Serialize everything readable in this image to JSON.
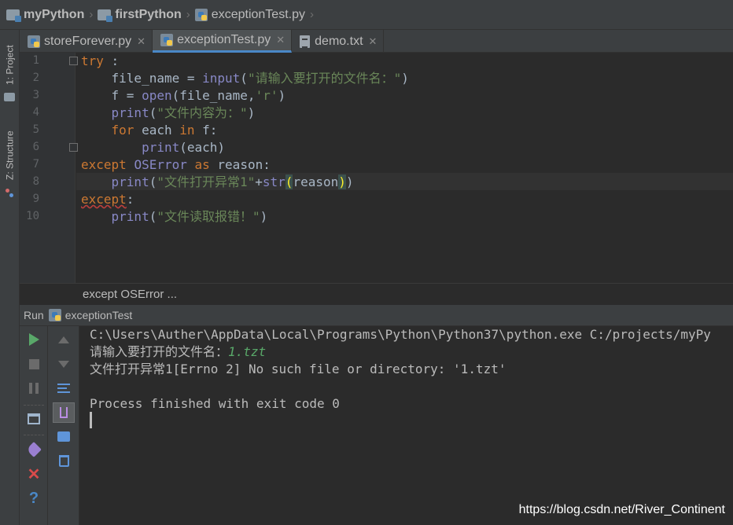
{
  "breadcrumb": [
    {
      "label": "myPython",
      "icon": "folder-icon"
    },
    {
      "label": "firstPython",
      "icon": "folder-icon"
    },
    {
      "label": "exceptionTest.py",
      "icon": "python-file-icon"
    }
  ],
  "sidebar": {
    "project_tab": "1: Project",
    "structure_tab": "Z: Structure"
  },
  "tabs": [
    {
      "label": "storeForever.py",
      "icon": "python-file-icon",
      "active": false
    },
    {
      "label": "exceptionTest.py",
      "icon": "python-file-icon",
      "active": true
    },
    {
      "label": "demo.txt",
      "icon": "text-file-icon",
      "active": false
    }
  ],
  "editor": {
    "line_numbers": [
      "1",
      "2",
      "3",
      "4",
      "5",
      "6",
      "7",
      "8",
      "9",
      "10"
    ],
    "lines": {
      "l1_kw": "try",
      "l1_rest": " :",
      "l2_a": "    file_name = ",
      "l2_fn": "input",
      "l2_b": "(",
      "l2_str": "\"请输入要打开的文件名：\"",
      "l2_c": ")",
      "l3_a": "    f = ",
      "l3_fn": "open",
      "l3_b": "(file_name,",
      "l3_str": "'r'",
      "l3_c": ")",
      "l4_fn": "    print",
      "l4_b": "(",
      "l4_str": "\"文件内容为：\"",
      "l4_c": ")",
      "l5_kw1": "    for",
      "l5_a": " each ",
      "l5_kw2": "in",
      "l5_b": " f:",
      "l6_fn": "        print",
      "l6_b": "(each)",
      "l7_kw1": "except",
      "l7_a": " ",
      "l7_cls": "OSError",
      "l7_b": " ",
      "l7_kw2": "as",
      "l7_c": " reason:",
      "l8_fn": "    print",
      "l8_b": "(",
      "l8_str": "\"文件打开异常1\"",
      "l8_c": "+",
      "l8_fn2": "str",
      "l8_p1": "(",
      "l8_d": "reason",
      "l8_p2": ")",
      "l8_e": ")",
      "l9_kw": "except",
      "l9_rest": ":",
      "l10_fn": "    print",
      "l10_b": "(",
      "l10_str": "\"文件读取报错！\"",
      "l10_c": ")"
    },
    "context_crumb": "except OSError ..."
  },
  "run_panel": {
    "label": "Run",
    "config_name": "exceptionTest",
    "output": {
      "cmd": "C:\\Users\\Auther\\AppData\\Local\\Programs\\Python\\Python37\\python.exe C:/projects/myPy",
      "prompt": "请输入要打开的文件名：",
      "user_input": "1.tzt",
      "error_line": "文件打开异常1[Errno 2] No such file or directory: '1.tzt'",
      "exit_line": "Process finished with exit code 0"
    }
  },
  "watermark": "https://blog.csdn.net/River_Continent",
  "colors": {
    "keyword": "#cc7832",
    "builtin": "#8888c6",
    "string": "#6a8759",
    "input_text": "#59a869"
  }
}
